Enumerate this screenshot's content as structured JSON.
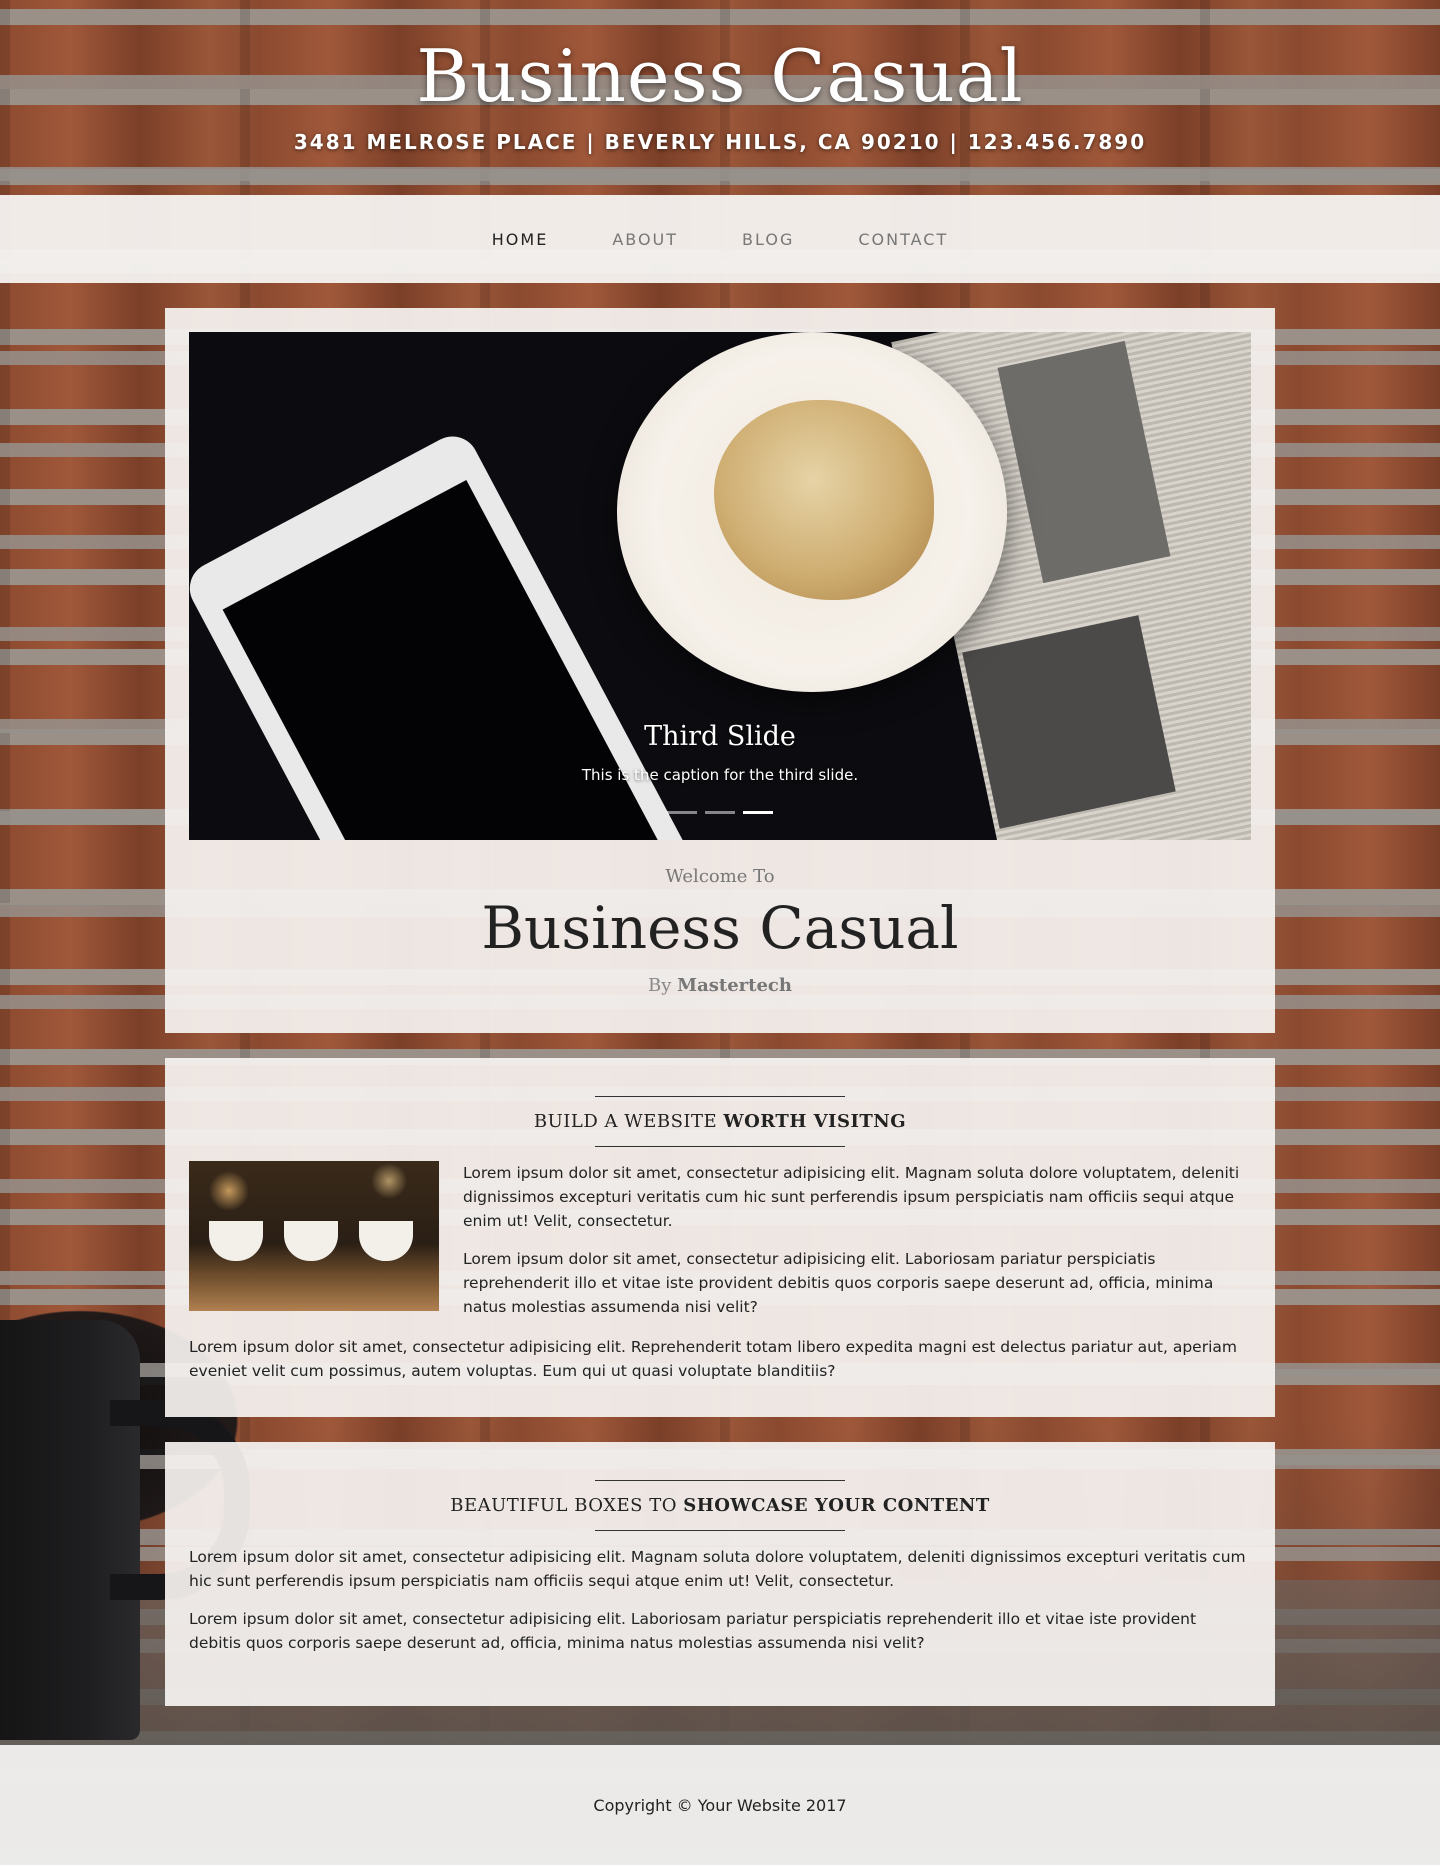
{
  "header": {
    "title": "Business Casual",
    "address": "3481 MELROSE PLACE | BEVERLY HILLS, CA 90210 | 123.456.7890"
  },
  "nav": {
    "items": [
      {
        "label": "HOME",
        "active": true
      },
      {
        "label": "ABOUT",
        "active": false
      },
      {
        "label": "BLOG",
        "active": false
      },
      {
        "label": "CONTACT",
        "active": false
      }
    ]
  },
  "carousel": {
    "caption_title": "Third Slide",
    "caption_text": "This is the caption for the third slide.",
    "slide_count": 3,
    "active_slide": 3
  },
  "welcome": {
    "subtitle": "Welcome To",
    "title": "Business Casual",
    "by_prefix": "By",
    "author": "Mastertech"
  },
  "section1": {
    "heading_light": "BUILD A WEBSITE",
    "heading_bold": "WORTH VISITNG",
    "para1": "Lorem ipsum dolor sit amet, consectetur adipisicing elit. Magnam soluta dolore voluptatem, deleniti dignissimos excepturi veritatis cum hic sunt perferendis ipsum perspiciatis nam officiis sequi atque enim ut! Velit, consectetur.",
    "para2": "Lorem ipsum dolor sit amet, consectetur adipisicing elit. Laboriosam pariatur perspiciatis reprehenderit illo et vitae iste provident debitis quos corporis saepe deserunt ad, officia, minima natus molestias assumenda nisi velit?",
    "para3": "Lorem ipsum dolor sit amet, consectetur adipisicing elit. Reprehenderit totam libero expedita magni est delectus pariatur aut, aperiam eveniet velit cum possimus, autem voluptas. Eum qui ut quasi voluptate blanditiis?"
  },
  "section2": {
    "heading_light": "BEAUTIFUL BOXES TO",
    "heading_bold": "SHOWCASE YOUR CONTENT",
    "para1": "Lorem ipsum dolor sit amet, consectetur adipisicing elit. Magnam soluta dolore voluptatem, deleniti dignissimos excepturi veritatis cum hic sunt perferendis ipsum perspiciatis nam officiis sequi atque enim ut! Velit, consectetur.",
    "para2": "Lorem ipsum dolor sit amet, consectetur adipisicing elit. Laboriosam pariatur perspiciatis reprehenderit illo et vitae iste provident debitis quos corporis saepe deserunt ad, officia, minima natus molestias assumenda nisi velit?"
  },
  "footer": {
    "copyright": "Copyright © Your Website 2017"
  },
  "colors": {
    "brick": "#8b4a30",
    "panel": "#f5f2f0",
    "text": "#222222",
    "nav_inactive": "#777777"
  }
}
